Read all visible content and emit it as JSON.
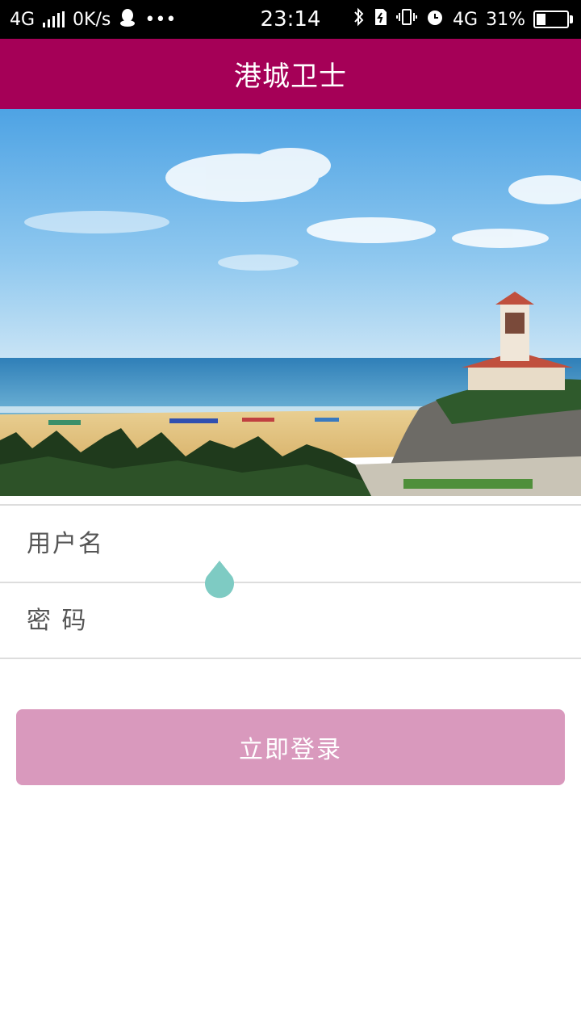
{
  "status_bar": {
    "network_left": "4G",
    "speed": "0K/s",
    "dots": "•••",
    "time": "23:14",
    "network_right": "4G",
    "battery_text": "31%",
    "battery_level": 0.31,
    "icons": [
      "signal-icon",
      "qq-icon",
      "bluetooth-icon",
      "sim-icon",
      "vibrate-icon",
      "alarm-icon",
      "battery-icon"
    ]
  },
  "app_bar": {
    "title": "港城卫士",
    "color": "#a50057"
  },
  "form": {
    "username_placeholder": "用户名",
    "password_placeholder": "密 码",
    "username_value": "",
    "password_value": ""
  },
  "login": {
    "label": "立即登录",
    "color": "#d999bd"
  },
  "cursor_handle_color": "#7ecbc3"
}
